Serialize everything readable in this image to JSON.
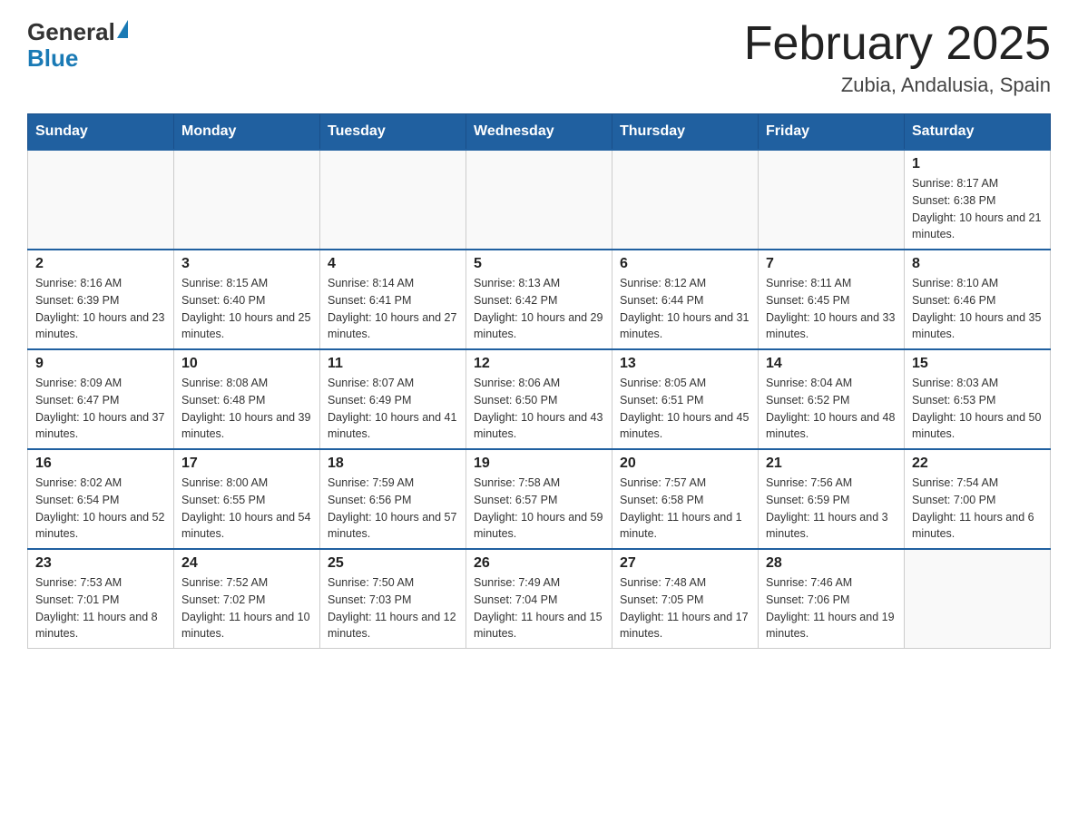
{
  "header": {
    "logo_general": "General",
    "logo_blue": "Blue",
    "month_title": "February 2025",
    "location": "Zubia, Andalusia, Spain"
  },
  "weekdays": [
    "Sunday",
    "Monday",
    "Tuesday",
    "Wednesday",
    "Thursday",
    "Friday",
    "Saturday"
  ],
  "weeks": [
    [
      {
        "day": "",
        "info": ""
      },
      {
        "day": "",
        "info": ""
      },
      {
        "day": "",
        "info": ""
      },
      {
        "day": "",
        "info": ""
      },
      {
        "day": "",
        "info": ""
      },
      {
        "day": "",
        "info": ""
      },
      {
        "day": "1",
        "info": "Sunrise: 8:17 AM\nSunset: 6:38 PM\nDaylight: 10 hours and 21 minutes."
      }
    ],
    [
      {
        "day": "2",
        "info": "Sunrise: 8:16 AM\nSunset: 6:39 PM\nDaylight: 10 hours and 23 minutes."
      },
      {
        "day": "3",
        "info": "Sunrise: 8:15 AM\nSunset: 6:40 PM\nDaylight: 10 hours and 25 minutes."
      },
      {
        "day": "4",
        "info": "Sunrise: 8:14 AM\nSunset: 6:41 PM\nDaylight: 10 hours and 27 minutes."
      },
      {
        "day": "5",
        "info": "Sunrise: 8:13 AM\nSunset: 6:42 PM\nDaylight: 10 hours and 29 minutes."
      },
      {
        "day": "6",
        "info": "Sunrise: 8:12 AM\nSunset: 6:44 PM\nDaylight: 10 hours and 31 minutes."
      },
      {
        "day": "7",
        "info": "Sunrise: 8:11 AM\nSunset: 6:45 PM\nDaylight: 10 hours and 33 minutes."
      },
      {
        "day": "8",
        "info": "Sunrise: 8:10 AM\nSunset: 6:46 PM\nDaylight: 10 hours and 35 minutes."
      }
    ],
    [
      {
        "day": "9",
        "info": "Sunrise: 8:09 AM\nSunset: 6:47 PM\nDaylight: 10 hours and 37 minutes."
      },
      {
        "day": "10",
        "info": "Sunrise: 8:08 AM\nSunset: 6:48 PM\nDaylight: 10 hours and 39 minutes."
      },
      {
        "day": "11",
        "info": "Sunrise: 8:07 AM\nSunset: 6:49 PM\nDaylight: 10 hours and 41 minutes."
      },
      {
        "day": "12",
        "info": "Sunrise: 8:06 AM\nSunset: 6:50 PM\nDaylight: 10 hours and 43 minutes."
      },
      {
        "day": "13",
        "info": "Sunrise: 8:05 AM\nSunset: 6:51 PM\nDaylight: 10 hours and 45 minutes."
      },
      {
        "day": "14",
        "info": "Sunrise: 8:04 AM\nSunset: 6:52 PM\nDaylight: 10 hours and 48 minutes."
      },
      {
        "day": "15",
        "info": "Sunrise: 8:03 AM\nSunset: 6:53 PM\nDaylight: 10 hours and 50 minutes."
      }
    ],
    [
      {
        "day": "16",
        "info": "Sunrise: 8:02 AM\nSunset: 6:54 PM\nDaylight: 10 hours and 52 minutes."
      },
      {
        "day": "17",
        "info": "Sunrise: 8:00 AM\nSunset: 6:55 PM\nDaylight: 10 hours and 54 minutes."
      },
      {
        "day": "18",
        "info": "Sunrise: 7:59 AM\nSunset: 6:56 PM\nDaylight: 10 hours and 57 minutes."
      },
      {
        "day": "19",
        "info": "Sunrise: 7:58 AM\nSunset: 6:57 PM\nDaylight: 10 hours and 59 minutes."
      },
      {
        "day": "20",
        "info": "Sunrise: 7:57 AM\nSunset: 6:58 PM\nDaylight: 11 hours and 1 minute."
      },
      {
        "day": "21",
        "info": "Sunrise: 7:56 AM\nSunset: 6:59 PM\nDaylight: 11 hours and 3 minutes."
      },
      {
        "day": "22",
        "info": "Sunrise: 7:54 AM\nSunset: 7:00 PM\nDaylight: 11 hours and 6 minutes."
      }
    ],
    [
      {
        "day": "23",
        "info": "Sunrise: 7:53 AM\nSunset: 7:01 PM\nDaylight: 11 hours and 8 minutes."
      },
      {
        "day": "24",
        "info": "Sunrise: 7:52 AM\nSunset: 7:02 PM\nDaylight: 11 hours and 10 minutes."
      },
      {
        "day": "25",
        "info": "Sunrise: 7:50 AM\nSunset: 7:03 PM\nDaylight: 11 hours and 12 minutes."
      },
      {
        "day": "26",
        "info": "Sunrise: 7:49 AM\nSunset: 7:04 PM\nDaylight: 11 hours and 15 minutes."
      },
      {
        "day": "27",
        "info": "Sunrise: 7:48 AM\nSunset: 7:05 PM\nDaylight: 11 hours and 17 minutes."
      },
      {
        "day": "28",
        "info": "Sunrise: 7:46 AM\nSunset: 7:06 PM\nDaylight: 11 hours and 19 minutes."
      },
      {
        "day": "",
        "info": ""
      }
    ]
  ]
}
